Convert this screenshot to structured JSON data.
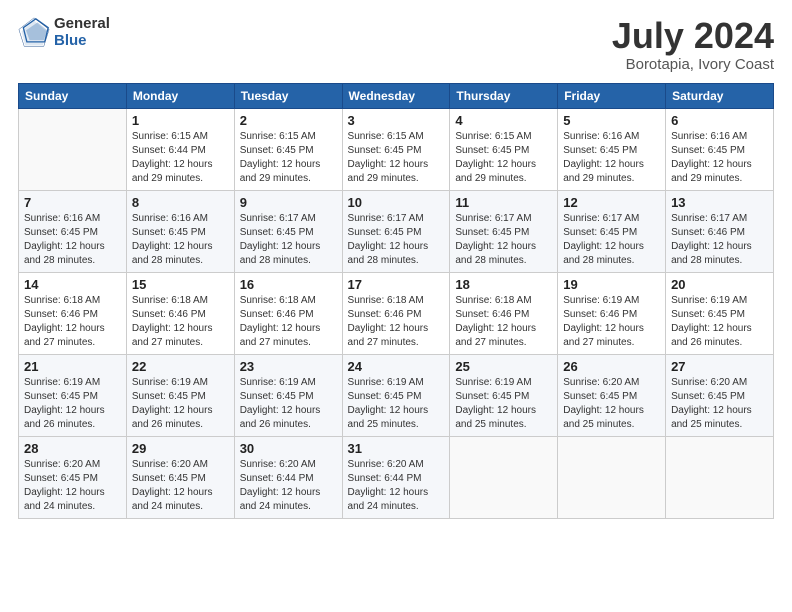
{
  "logo": {
    "general": "General",
    "blue": "Blue"
  },
  "title": "July 2024",
  "location": "Borotapia, Ivory Coast",
  "days_of_week": [
    "Sunday",
    "Monday",
    "Tuesday",
    "Wednesday",
    "Thursday",
    "Friday",
    "Saturday"
  ],
  "weeks": [
    [
      {
        "day": "",
        "info": ""
      },
      {
        "day": "1",
        "info": "Sunrise: 6:15 AM\nSunset: 6:44 PM\nDaylight: 12 hours\nand 29 minutes."
      },
      {
        "day": "2",
        "info": "Sunrise: 6:15 AM\nSunset: 6:45 PM\nDaylight: 12 hours\nand 29 minutes."
      },
      {
        "day": "3",
        "info": "Sunrise: 6:15 AM\nSunset: 6:45 PM\nDaylight: 12 hours\nand 29 minutes."
      },
      {
        "day": "4",
        "info": "Sunrise: 6:15 AM\nSunset: 6:45 PM\nDaylight: 12 hours\nand 29 minutes."
      },
      {
        "day": "5",
        "info": "Sunrise: 6:16 AM\nSunset: 6:45 PM\nDaylight: 12 hours\nand 29 minutes."
      },
      {
        "day": "6",
        "info": "Sunrise: 6:16 AM\nSunset: 6:45 PM\nDaylight: 12 hours\nand 29 minutes."
      }
    ],
    [
      {
        "day": "7",
        "info": ""
      },
      {
        "day": "8",
        "info": "Sunrise: 6:16 AM\nSunset: 6:45 PM\nDaylight: 12 hours\nand 28 minutes."
      },
      {
        "day": "9",
        "info": "Sunrise: 6:17 AM\nSunset: 6:45 PM\nDaylight: 12 hours\nand 28 minutes."
      },
      {
        "day": "10",
        "info": "Sunrise: 6:17 AM\nSunset: 6:45 PM\nDaylight: 12 hours\nand 28 minutes."
      },
      {
        "day": "11",
        "info": "Sunrise: 6:17 AM\nSunset: 6:45 PM\nDaylight: 12 hours\nand 28 minutes."
      },
      {
        "day": "12",
        "info": "Sunrise: 6:17 AM\nSunset: 6:45 PM\nDaylight: 12 hours\nand 28 minutes."
      },
      {
        "day": "13",
        "info": "Sunrise: 6:17 AM\nSunset: 6:46 PM\nDaylight: 12 hours\nand 28 minutes."
      }
    ],
    [
      {
        "day": "14",
        "info": ""
      },
      {
        "day": "15",
        "info": "Sunrise: 6:18 AM\nSunset: 6:46 PM\nDaylight: 12 hours\nand 27 minutes."
      },
      {
        "day": "16",
        "info": "Sunrise: 6:18 AM\nSunset: 6:46 PM\nDaylight: 12 hours\nand 27 minutes."
      },
      {
        "day": "17",
        "info": "Sunrise: 6:18 AM\nSunset: 6:46 PM\nDaylight: 12 hours\nand 27 minutes."
      },
      {
        "day": "18",
        "info": "Sunrise: 6:18 AM\nSunset: 6:46 PM\nDaylight: 12 hours\nand 27 minutes."
      },
      {
        "day": "19",
        "info": "Sunrise: 6:19 AM\nSunset: 6:46 PM\nDaylight: 12 hours\nand 27 minutes."
      },
      {
        "day": "20",
        "info": "Sunrise: 6:19 AM\nSunset: 6:45 PM\nDaylight: 12 hours\nand 26 minutes."
      }
    ],
    [
      {
        "day": "21",
        "info": ""
      },
      {
        "day": "22",
        "info": "Sunrise: 6:19 AM\nSunset: 6:45 PM\nDaylight: 12 hours\nand 26 minutes."
      },
      {
        "day": "23",
        "info": "Sunrise: 6:19 AM\nSunset: 6:45 PM\nDaylight: 12 hours\nand 26 minutes."
      },
      {
        "day": "24",
        "info": "Sunrise: 6:19 AM\nSunset: 6:45 PM\nDaylight: 12 hours\nand 25 minutes."
      },
      {
        "day": "25",
        "info": "Sunrise: 6:19 AM\nSunset: 6:45 PM\nDaylight: 12 hours\nand 25 minutes."
      },
      {
        "day": "26",
        "info": "Sunrise: 6:20 AM\nSunset: 6:45 PM\nDaylight: 12 hours\nand 25 minutes."
      },
      {
        "day": "27",
        "info": "Sunrise: 6:20 AM\nSunset: 6:45 PM\nDaylight: 12 hours\nand 25 minutes."
      }
    ],
    [
      {
        "day": "28",
        "info": "Sunrise: 6:20 AM\nSunset: 6:45 PM\nDaylight: 12 hours\nand 24 minutes."
      },
      {
        "day": "29",
        "info": "Sunrise: 6:20 AM\nSunset: 6:45 PM\nDaylight: 12 hours\nand 24 minutes."
      },
      {
        "day": "30",
        "info": "Sunrise: 6:20 AM\nSunset: 6:44 PM\nDaylight: 12 hours\nand 24 minutes."
      },
      {
        "day": "31",
        "info": "Sunrise: 6:20 AM\nSunset: 6:44 PM\nDaylight: 12 hours\nand 24 minutes."
      },
      {
        "day": "",
        "info": ""
      },
      {
        "day": "",
        "info": ""
      },
      {
        "day": "",
        "info": ""
      }
    ]
  ],
  "week7_sun_info": "Daylight: 12 hours\nand 28 minutes.",
  "week7_sun_sunrise": "Sunrise: 6:16 AM",
  "week7_sun_sunset": "Sunset: 6:45 PM",
  "week3_sun_info": "Sunrise: 6:18 AM\nSunset: 6:46 PM\nDaylight: 12 hours\nand 27 minutes.",
  "week4_sun_info": "Sunrise: 6:19 AM\nSunset: 6:45 PM\nDaylight: 12 hours\nand 26 minutes."
}
